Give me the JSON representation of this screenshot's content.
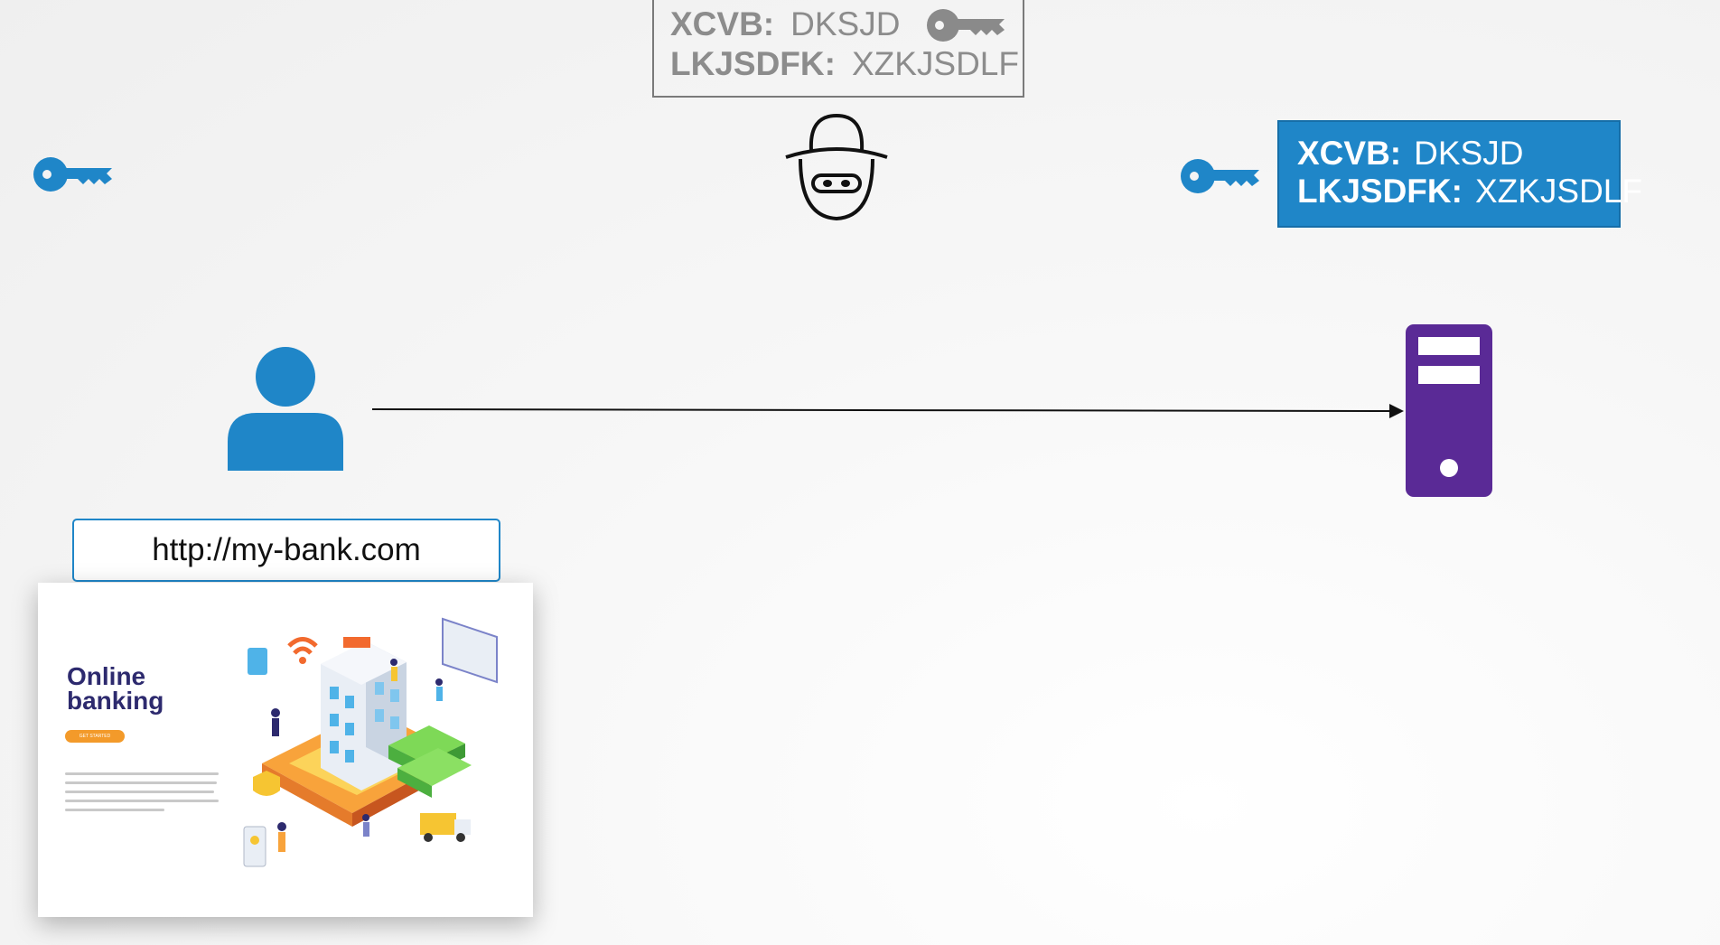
{
  "hacker_credentials": {
    "line1_key": "XCVB:",
    "line1_value": "DKSJD",
    "line2_key": "LKJSDFK:",
    "line2_value": "XZKJSDLF"
  },
  "server_credentials": {
    "line1_key": "XCVB:",
    "line1_value": "DKSJD",
    "line2_key": "LKJSDFK:",
    "line2_value": "XZKJSDLF"
  },
  "url": "http://my-bank.com",
  "website": {
    "title": "Online banking",
    "button_label": "GET STARTED"
  },
  "colors": {
    "key_blue": "#1f86c8",
    "key_grey": "#8a8a8a",
    "server_purple": "#5a2a96",
    "user_blue": "#1f86c8",
    "server_box_blue": "#1f86c8"
  },
  "icons": [
    "key-icon",
    "hacker-icon",
    "user-icon",
    "server-icon",
    "arrow"
  ]
}
